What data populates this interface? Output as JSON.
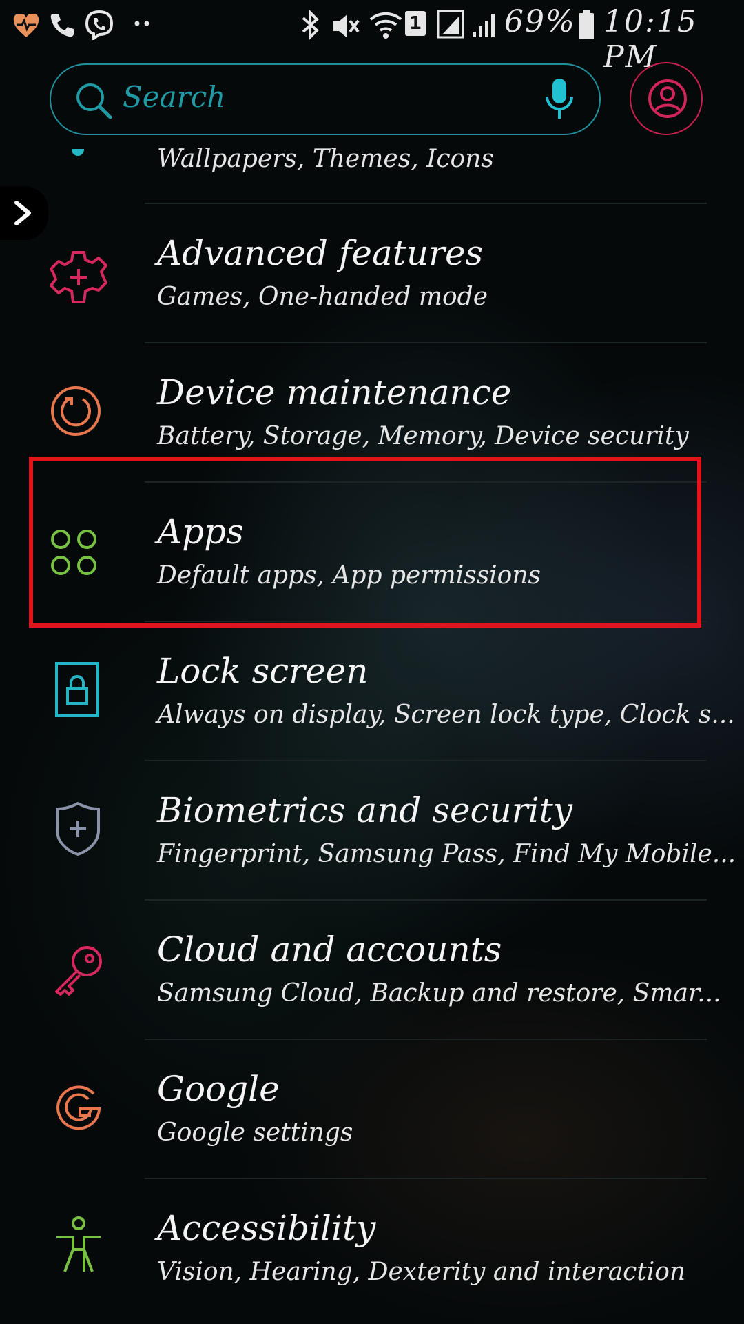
{
  "status_bar": {
    "battery": "69%",
    "time": "10:15 PM",
    "sim_slot": "1"
  },
  "search": {
    "placeholder": "Search"
  },
  "partial_item": {
    "subtitle": "Wallpapers, Themes, Icons"
  },
  "items": [
    {
      "title": "Advanced features",
      "subtitle": "Games, One-handed mode",
      "icon": "gear-plus-icon",
      "color": "#d6275e"
    },
    {
      "title": "Device maintenance",
      "subtitle": "Battery, Storage, Memory, Device security",
      "icon": "refresh-circle-icon",
      "color": "#e9774e"
    },
    {
      "title": "Apps",
      "subtitle": "Default apps, App permissions",
      "icon": "apps-grid-icon",
      "color": "#79c142"
    },
    {
      "title": "Lock screen",
      "subtitle": "Always on display, Screen lock type, Clock s...",
      "icon": "lock-icon",
      "color": "#25b6c6"
    },
    {
      "title": "Biometrics and security",
      "subtitle": "Fingerprint, Samsung Pass, Find My Mobile...",
      "icon": "shield-plus-icon",
      "color": "#8b93a8"
    },
    {
      "title": "Cloud and accounts",
      "subtitle": "Samsung Cloud, Backup and restore, Smar...",
      "icon": "key-icon",
      "color": "#d6275e"
    },
    {
      "title": "Google",
      "subtitle": "Google settings",
      "icon": "google-icon",
      "color": "#e9774e"
    },
    {
      "title": "Accessibility",
      "subtitle": "Vision, Hearing, Dexterity and interaction",
      "icon": "accessibility-icon",
      "color": "#79c142"
    }
  ],
  "colors": {
    "search_border": "#1f8f9a",
    "profile_ring": "#c9204f",
    "highlight_box": "#e1141c"
  }
}
